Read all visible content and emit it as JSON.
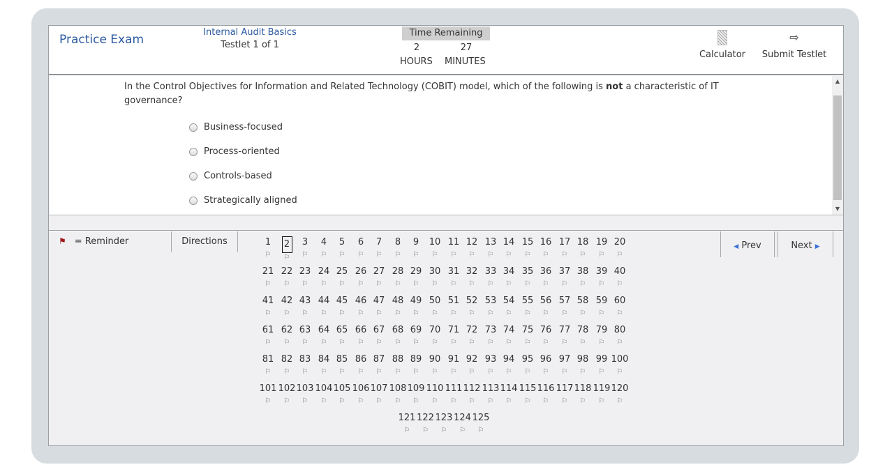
{
  "header": {
    "title": "Practice Exam",
    "exam_name": "Internal Audit Basics",
    "testlet": "Testlet 1 of 1",
    "timer": {
      "title": "Time Remaining",
      "hours": "2",
      "minutes": "27",
      "hours_label": "HOURS",
      "minutes_label": "MINUTES"
    },
    "calculator_label": "Calculator",
    "submit_label": "Submit Testlet"
  },
  "question": {
    "text_before": "In the Control Objectives for Information and Related Technology (COBIT) model, which of the following is ",
    "text_bold": "not",
    "text_after": " a characteristic of IT governance?",
    "options": [
      "Business-focused",
      "Process-oriented",
      "Controls-based",
      "Strategically aligned"
    ]
  },
  "navigation": {
    "reminder_label": "= Reminder",
    "directions_label": "Directions",
    "prev_label": "Prev",
    "next_label": "Next",
    "current_question": 2,
    "total_questions": 125
  }
}
